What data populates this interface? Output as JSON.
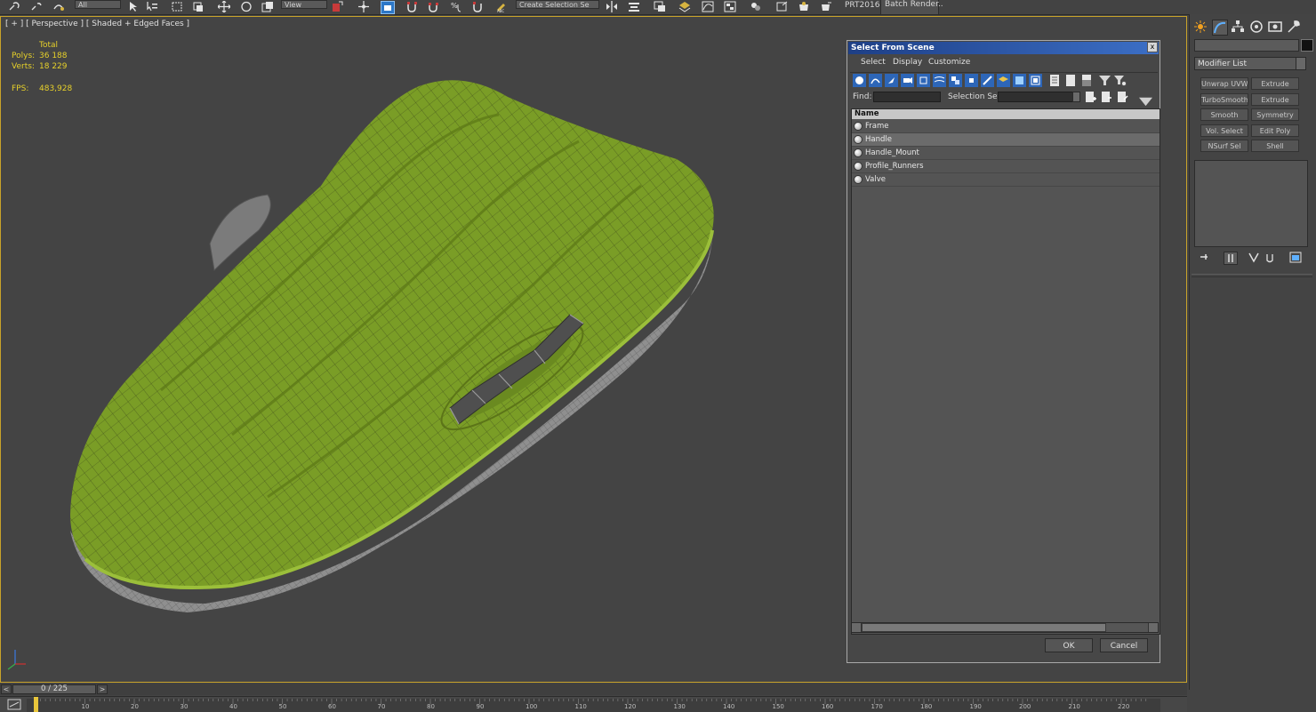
{
  "toolbar": {
    "filter_value": "All",
    "refcoord_value": "View",
    "named_sel_value": "Create Selection Se",
    "plugin_label": "PRT2016",
    "batch_render_label": "Batch Render..",
    "accent_color": "#2d78c8"
  },
  "viewport": {
    "label": "[ + ] [ Perspective ] [ Shaded + Edged Faces ]",
    "stats": {
      "header": "Total",
      "polys_label": "Polys:",
      "polys_value": "36 188",
      "verts_label": "Verts:",
      "verts_value": "18 229",
      "fps_label": "FPS:",
      "fps_value": "483,928"
    },
    "model_color": "#7a9d26",
    "border_color": "#c9a32a"
  },
  "dialog": {
    "title": "Select From Scene",
    "close_label": "x",
    "menu": [
      "Select",
      "Display",
      "Customize"
    ],
    "find_label": "Find:",
    "find_value": "",
    "selection_set_label": "Selection Set:",
    "selection_set_value": "",
    "column_header": "Name",
    "items": [
      {
        "label": "Frame",
        "selected": false
      },
      {
        "label": "Handle",
        "selected": true
      },
      {
        "label": "Handle_Mount",
        "selected": false
      },
      {
        "label": "Profile_Runners",
        "selected": false
      },
      {
        "label": "Valve",
        "selected": false
      }
    ],
    "ok_label": "OK",
    "cancel_label": "Cancel"
  },
  "command_panel": {
    "object_name": "",
    "modifier_list_label": "Modifier List",
    "modifier_buttons": [
      "Unwrap UVW",
      "Extrude",
      "TurboSmooth",
      "Extrude",
      "Smooth",
      "Symmetry",
      "Vol. Select",
      "Edit Poly",
      "NSurf Sel",
      "Shell"
    ]
  },
  "timeline": {
    "frame_display": "0 / 225",
    "prev_label": "<",
    "next_label": ">",
    "ruler_labels": [
      "10",
      "20",
      "30",
      "40",
      "50",
      "60",
      "70",
      "80",
      "90",
      "100",
      "110",
      "120",
      "130",
      "140",
      "150",
      "160",
      "170",
      "180",
      "190",
      "200",
      "210",
      "220"
    ]
  }
}
